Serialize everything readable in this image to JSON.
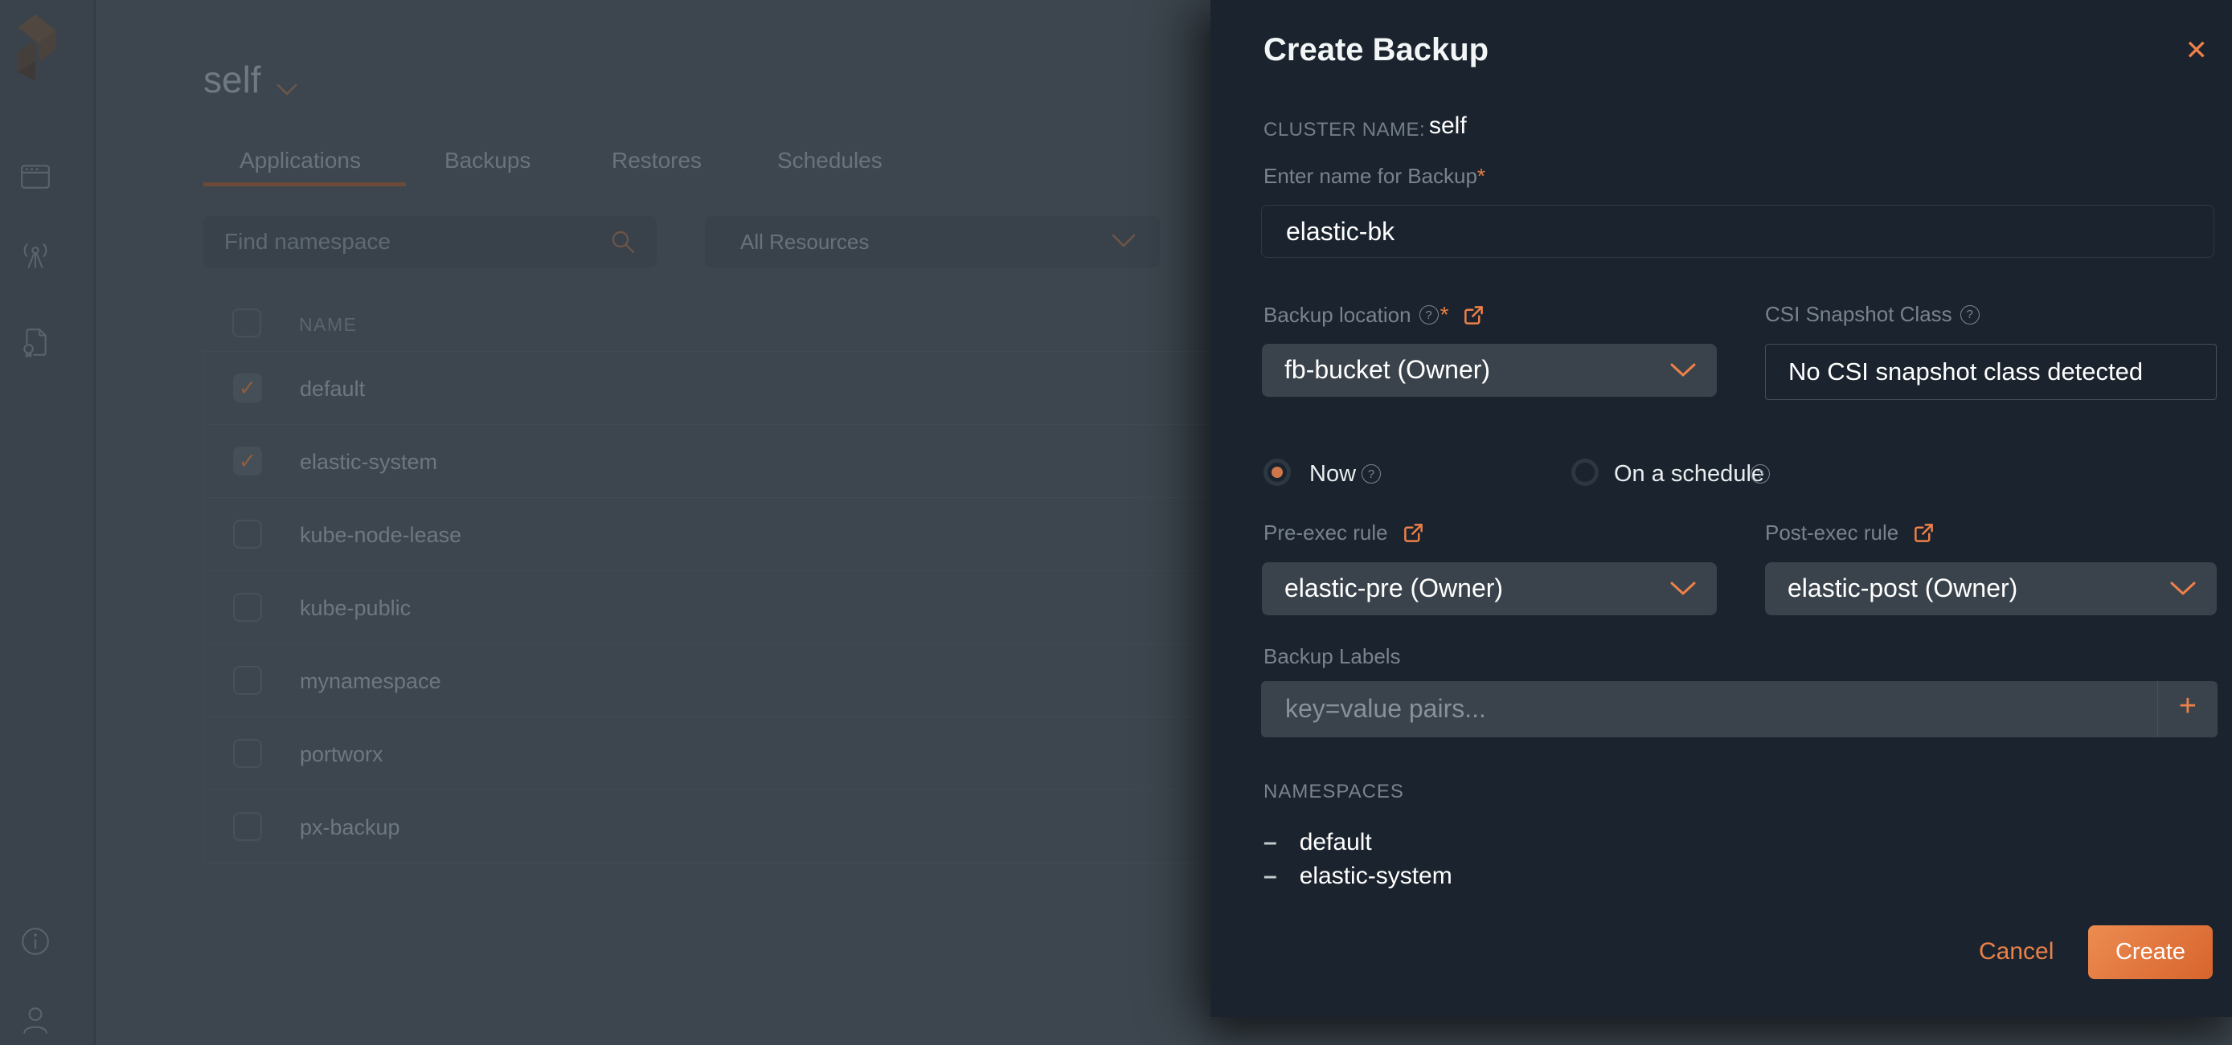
{
  "colors": {
    "accent_orange": "#ee8049",
    "modal_bg": "#1b242e",
    "page_bg": "#3d464e",
    "create_gradient_start": "#ec8c51",
    "create_gradient_end": "#d7642d"
  },
  "sidebar": {
    "logo": "portworx-logo",
    "icons": [
      {
        "name": "backups-window-icon"
      },
      {
        "name": "broadcast-antenna-icon"
      },
      {
        "name": "license-document-icon"
      },
      {
        "name": "info-icon"
      },
      {
        "name": "user-icon"
      }
    ]
  },
  "header": {
    "cluster_title": "self"
  },
  "tabs": [
    {
      "label": "Applications",
      "active": true
    },
    {
      "label": "Backups",
      "active": false
    },
    {
      "label": "Restores",
      "active": false
    },
    {
      "label": "Schedules",
      "active": false
    }
  ],
  "filters": {
    "search_placeholder": "Find namespace",
    "resources_dropdown_value": "All Resources"
  },
  "table": {
    "header": "NAME",
    "rows": [
      {
        "name": "default",
        "checked": true
      },
      {
        "name": "elastic-system",
        "checked": true
      },
      {
        "name": "kube-node-lease",
        "checked": false
      },
      {
        "name": "kube-public",
        "checked": false
      },
      {
        "name": "mynamespace",
        "checked": false
      },
      {
        "name": "portworx",
        "checked": false
      },
      {
        "name": "px-backup",
        "checked": false
      }
    ]
  },
  "modal": {
    "title": "Create Backup",
    "cluster_label": "CLUSTER NAME:",
    "cluster_value": "self",
    "name_label": "Enter name for Backup",
    "name_required_mark": "*",
    "name_value": "elastic-bk",
    "backup_location": {
      "label": "Backup location",
      "required_mark": "*",
      "value": "fb-bucket (Owner)"
    },
    "csi": {
      "label": "CSI Snapshot Class",
      "value": "No CSI snapshot class detected"
    },
    "schedule": {
      "now_label": "Now",
      "now_selected": true,
      "schedule_label": "On a schedule",
      "schedule_selected": false
    },
    "pre_exec": {
      "label": "Pre-exec rule",
      "value": "elastic-pre (Owner)"
    },
    "post_exec": {
      "label": "Post-exec rule",
      "value": "elastic-post (Owner)"
    },
    "backup_labels": {
      "label": "Backup Labels",
      "placeholder": "key=value pairs...",
      "add_button": "+"
    },
    "namespaces": {
      "label": "NAMESPACES",
      "items": [
        "default",
        "elastic-system"
      ]
    },
    "buttons": {
      "cancel": "Cancel",
      "create": "Create"
    }
  }
}
